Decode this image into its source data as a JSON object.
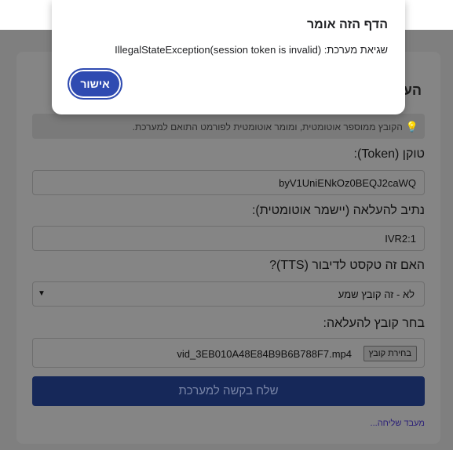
{
  "dialog": {
    "title": "הדף הזה אומר",
    "message": "שגיאת מערכת: IllegalStateException(session token is invalid)",
    "ok_label": "אישור"
  },
  "form": {
    "title": "הע",
    "hint": "הקובץ ממוספר אוטומטית, ומומר אוטומטית לפורמט התואם למערכת.",
    "hint_icon": "lightbulb-icon",
    "token_label": "טוקן (Token):",
    "token_value": "byV1UniENkOz0BEQJ2caWQ",
    "path_label": "נתיב להעלאה (יישמר אוטומטית):",
    "path_value": "IVR2:1",
    "tts_label": "האם זה טקסט לדיבור (TTS)?",
    "tts_selected": "לא - זה קובץ שמע",
    "file_label": "בחר קובץ להעלאה:",
    "file_button": "בחירת קובץ",
    "file_name": "vid_3EB010A48E84B9B6B788F7.mp4",
    "submit_label": "שלח בקשה למערכת",
    "status_text": "מעבד שליחה..."
  },
  "colors": {
    "dialog_button": "#2f4bb1",
    "submit_button": "#162859",
    "overlay": "#7f7f7f"
  }
}
